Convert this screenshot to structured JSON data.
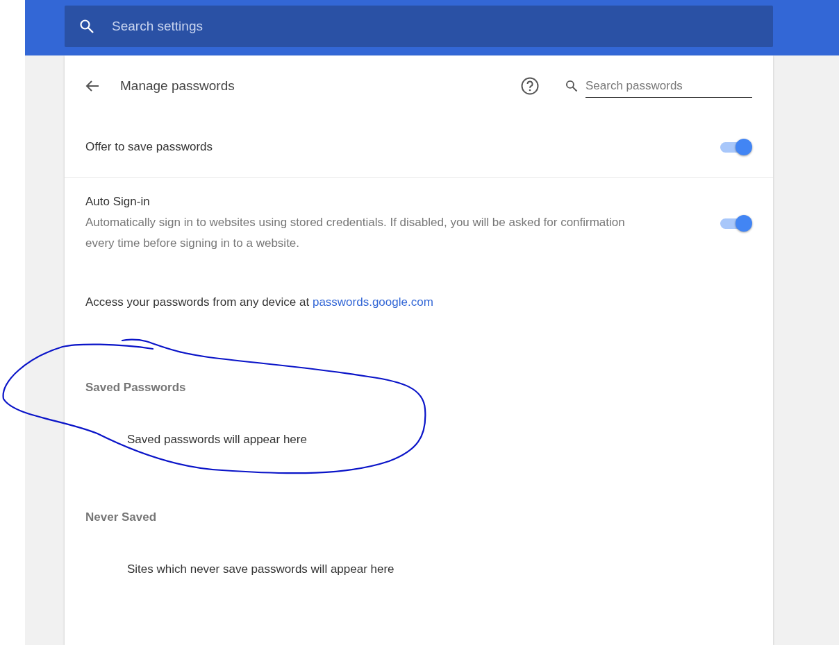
{
  "search": {
    "placeholder": "Search settings"
  },
  "page": {
    "title": "Manage passwords",
    "search_placeholder": "Search passwords"
  },
  "settings": [
    {
      "label": "Offer to save passwords",
      "on": true
    },
    {
      "label": "Auto Sign-in",
      "description": "Automatically sign in to websites using stored credentials. If disabled, you will be asked for confirmation every time before signing in to a website.",
      "on": true
    }
  ],
  "access": {
    "text": "Access your passwords from any device at",
    "link": "passwords.google.com"
  },
  "sections": [
    {
      "heading": "Saved Passwords",
      "empty": "Saved passwords will appear here"
    },
    {
      "heading": "Never Saved",
      "empty": "Sites which never save passwords will appear here"
    }
  ],
  "annotations": [
    {
      "kind": "freehand-loop",
      "color": "#0a14c8"
    }
  ]
}
